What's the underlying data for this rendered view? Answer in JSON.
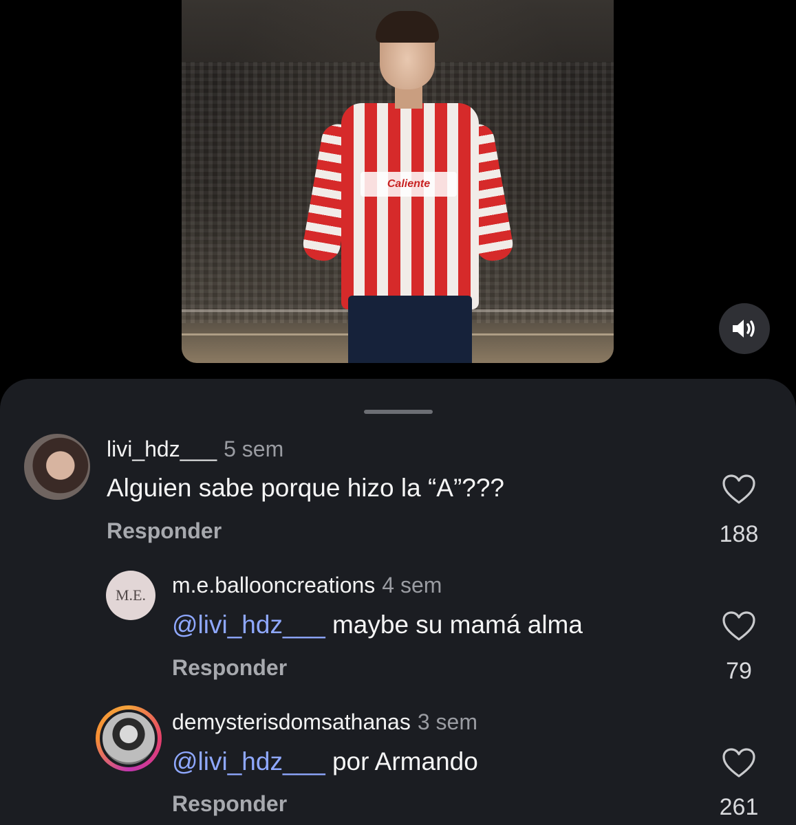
{
  "video": {
    "sponsor_text": "Caliente",
    "mute_icon": "speaker-icon"
  },
  "comments": [
    {
      "username": "livi_hdz___",
      "time": "5 sem",
      "text": "Alguien sabe porque hizo la “A”???",
      "reply_label": "Responder",
      "likes": "188"
    },
    {
      "username": "m.e.ballooncreations",
      "time": "4 sem",
      "avatar_text": "M.E.",
      "mention": "@livi_hdz___",
      "text": "maybe su mamá alma",
      "reply_label": "Responder",
      "likes": "79"
    },
    {
      "username": "demysterisdomsathanas",
      "time": "3 sem",
      "mention": "@livi_hdz___",
      "text": "por Armando",
      "reply_label": "Responder",
      "likes": "261"
    }
  ],
  "colors": {
    "sheet_bg": "#1b1d22",
    "mention": "#8fa8ff",
    "muted_text": "#9a9ca2"
  }
}
